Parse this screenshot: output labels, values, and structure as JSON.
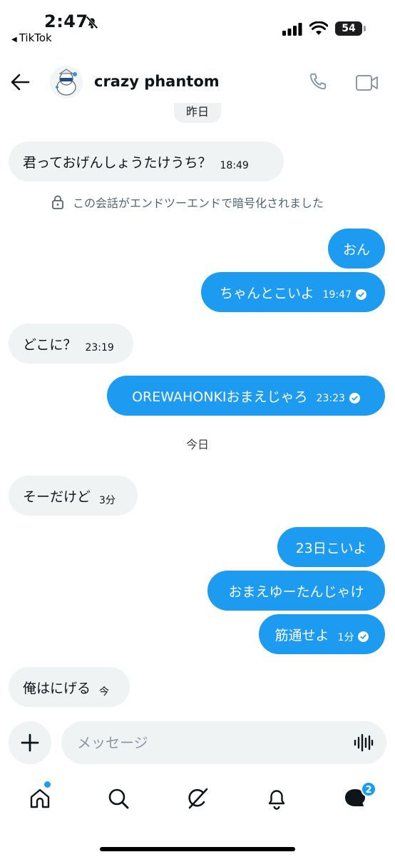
{
  "status_bar": {
    "time": "2:47",
    "back_app": "TikTok",
    "battery": "54"
  },
  "header": {
    "contact_name": "crazy phantom"
  },
  "dates": {
    "yesterday": "昨日",
    "today": "今日"
  },
  "encryption_note": "この会話がエンドツーエンドで暗号化されました",
  "messages": [
    {
      "dir": "in",
      "text": "君っておげんしょうたけうち？",
      "time": "18:49"
    },
    {
      "dir": "out",
      "text": "おん",
      "time": ""
    },
    {
      "dir": "out",
      "text": "ちゃんとこいよ",
      "time": "19:47",
      "read": true
    },
    {
      "dir": "in",
      "text": "どこに？",
      "time": "23:19"
    },
    {
      "dir": "out",
      "text": "OREWAHONKIおまえじゃろ",
      "time": "23:23",
      "read": true
    },
    {
      "dir": "in",
      "text": "そーだけど",
      "time": "3分"
    },
    {
      "dir": "out",
      "text": "23日こいよ",
      "time": ""
    },
    {
      "dir": "out",
      "text": "おまえゆーたんじゃけ",
      "time": ""
    },
    {
      "dir": "out",
      "text": "筋通せよ",
      "time": "1分",
      "read": true
    },
    {
      "dir": "in",
      "text": "俺はにげる",
      "time": "今"
    }
  ],
  "composer": {
    "placeholder": "メッセージ"
  },
  "nav": {
    "items": [
      "home-icon",
      "search-icon",
      "grok-icon",
      "bell-icon",
      "messages-icon"
    ],
    "messages_badge": "2"
  },
  "colors": {
    "accent": "#1d9bf0",
    "incoming_bubble": "#eff3f4",
    "muted": "#536471"
  }
}
